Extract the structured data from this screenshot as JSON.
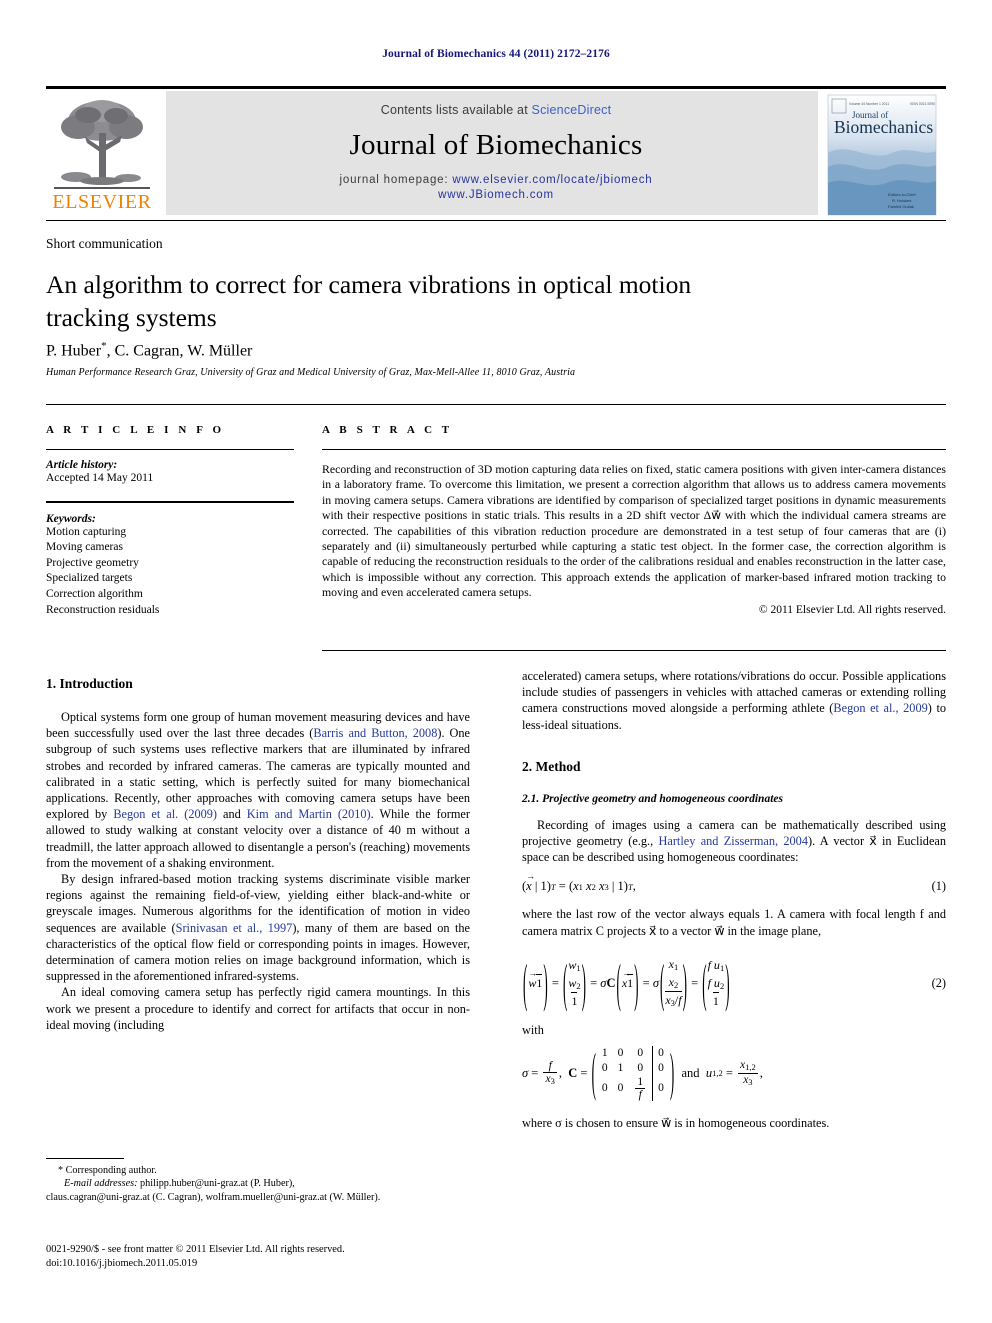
{
  "running_head": "Journal of Biomechanics 44 (2011) 2172–2176",
  "masthead": {
    "contents_prefix": "Contents lists available at ",
    "contents_link": "ScienceDirect",
    "journal_title": "Journal of Biomechanics",
    "homepage_label": "journal homepage: ",
    "homepage_url_1": "www.elsevier.com/locate/jbiomech",
    "homepage_url_2": "www.JBiomech.com",
    "publisher_name": "ELSEVIER",
    "cover_title_line1": "Journal of",
    "cover_title_line2": "Biomechanics",
    "link_color": "#3a5fcd",
    "band_color": "#e3e3e3",
    "publisher_color": "#f08000"
  },
  "article": {
    "kicker": "Short communication",
    "title": "An algorithm to correct for camera vibrations in optical motion tracking systems",
    "authors": "P. Huber",
    "authors_rest": ", C. Cagran, W. Müller",
    "corresponding_marker": "*",
    "affiliation": "Human Performance Research Graz, University of Graz and Medical University of Graz, Max-Mell-Allee 11, 8010 Graz, Austria"
  },
  "article_info": {
    "heading": "A R T I C L E   I N F O",
    "history_label": "Article history:",
    "history_value": "Accepted 14 May 2011",
    "keywords_label": "Keywords:",
    "keywords": [
      "Motion capturing",
      "Moving cameras",
      "Projective geometry",
      "Specialized targets",
      "Correction algorithm",
      "Reconstruction residuals"
    ]
  },
  "abstract": {
    "heading": "A B S T R A C T",
    "text": "Recording and reconstruction of 3D motion capturing data relies on fixed, static camera positions with given inter-camera distances in a laboratory frame. To overcome this limitation, we present a correction algorithm that allows us to address camera movements in moving camera setups. Camera vibrations are identified by comparison of specialized target positions in dynamic measurements with their respective positions in static trials. This results in a 2D shift vector Δw⃗ with which the individual camera streams are corrected. The capabilities of this vibration reduction procedure are demonstrated in a test setup of four cameras that are (i) separately and (ii) simultaneously perturbed while capturing a static test object. In the former case, the correction algorithm is capable of reducing the reconstruction residuals to the order of the calibrations residual and enables reconstruction in the latter case, which is impossible without any correction. This approach extends the application of marker-based infrared motion tracking to moving and even accelerated camera setups.",
    "copyright": "© 2011 Elsevier Ltd. All rights reserved."
  },
  "sections": {
    "intro_heading": "1. Introduction",
    "intro_p1_a": "Optical systems form one group of human movement measuring devices and have been successfully used over the last three decades (",
    "intro_p1_cite1": "Barris and Button, 2008",
    "intro_p1_b": "). One subgroup of such systems uses reflective markers that are illuminated by infrared strobes and recorded by infrared cameras. The cameras are typically mounted and calibrated in a static setting, which is perfectly suited for many biomechanical applications. Recently, other approaches with comoving camera setups have been explored by ",
    "intro_p1_cite2": "Begon et al. (2009)",
    "intro_p1_c": " and ",
    "intro_p1_cite3": "Kim and Martin (2010)",
    "intro_p1_d": ". While the former allowed to study walking at constant velocity over a distance of 40 m without a treadmill, the latter approach allowed to disentangle a person's (reaching) movements from the movement of a shaking environment.",
    "intro_p2_a": "By design infrared-based motion tracking systems discriminate visible marker regions against the remaining field-of-view, yielding either black-and-white or greyscale images. Numerous algorithms for the identification of motion in video sequences are available (",
    "intro_p2_cite1": "Srinivasan et al., 1997",
    "intro_p2_b": "), many of them are based on the characteristics of the optical flow field or corresponding points in images. However, determination of camera motion relies on image background information, which is suppressed in the aforementioned infrared-systems.",
    "intro_p3": "An ideal comoving camera setup has perfectly rigid camera mountings. In this work we present a procedure to identify and correct for artifacts that occur in non-ideal moving (including",
    "right_p1_a": "accelerated) camera setups, where rotations/vibrations do occur. Possible applications include studies of passengers in vehicles with attached cameras or extending rolling camera constructions moved alongside a performing athlete (",
    "right_p1_cite": "Begon et al., 2009",
    "right_p1_b": ") to less-ideal situations.",
    "method_heading": "2. Method",
    "method_sub_heading": "2.1. Projective geometry and homogeneous coordinates",
    "method_p1_a": "Recording of images using a camera can be mathematically described using projective geometry (e.g., ",
    "method_p1_cite": "Hartley and Zisserman, 2004",
    "method_p1_b": "). A vector x⃗ in Euclidean space can be described using homogeneous coordinates:",
    "eq1_number": "(1)",
    "after_eq1": "where the last row of the vector always equals 1. A camera with focal length f and camera matrix C projects x⃗ to a vector w⃗ in the image plane,",
    "eq2_number": "(2)",
    "with_label": "with",
    "after_eq3": "where σ is chosen to ensure w⃗ is in homogeneous coordinates."
  },
  "footnote": {
    "corresponding": "* Corresponding author.",
    "email_label": "E-mail addresses:",
    "email_1": "philipp.huber@uni-graz.at (P. Huber),",
    "email_2": "claus.cagran@uni-graz.at (C. Cagran), wolfram.mueller@uni-graz.at (W. Müller).",
    "imprint_1": "0021-9290/$ - see front matter © 2011 Elsevier Ltd. All rights reserved.",
    "imprint_2": "doi:10.1016/j.jbiomech.2011.05.019"
  }
}
